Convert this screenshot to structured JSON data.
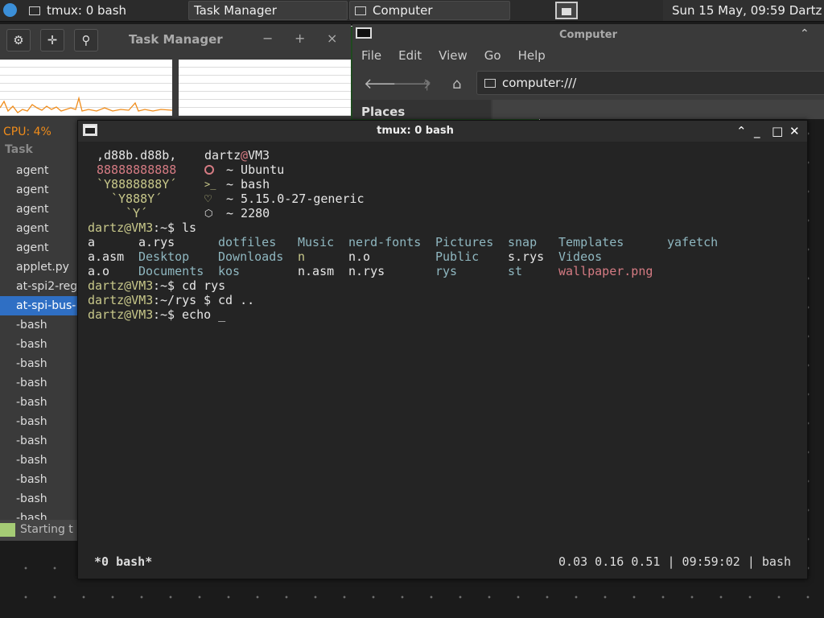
{
  "taskbar": {
    "windows": [
      {
        "label": "tmux: 0 bash"
      },
      {
        "label": "Task Manager"
      },
      {
        "label": "Computer"
      }
    ],
    "clock": "Sun 15 May, 09:59  Dartz"
  },
  "task_manager": {
    "title": "Task Manager",
    "cpu_label": "CPU: 4%",
    "column_header": "Task",
    "tasks": [
      "agent",
      "agent",
      "agent",
      "agent",
      "agent",
      "applet.py",
      "at-spi2-reg",
      "at-spi-bus-",
      "-bash",
      "-bash",
      "-bash",
      "-bash",
      "-bash",
      "-bash",
      "-bash",
      "-bash",
      "-bash",
      "-bash",
      "-bash"
    ],
    "selected_index": 7,
    "status": "Starting t"
  },
  "file_manager": {
    "title": "Computer",
    "menu": [
      "File",
      "Edit",
      "View",
      "Go",
      "Help"
    ],
    "location": "computer:///",
    "places_label": "Places"
  },
  "terminal": {
    "title": "tmux: 0 bash",
    "neofetch": {
      "art": [
        ",d88b.d88b,",
        "88888888888",
        "`Y8888888Y´",
        "`Y888Y´",
        "`Y´"
      ],
      "user": "dartz",
      "at": "@",
      "host": "VM3",
      "os": "~ Ubuntu",
      "shell_icon": ">_",
      "shell": "~ bash",
      "kernel": "~ 5.15.0-27-generic",
      "packages": "~ 2280"
    },
    "prompts": {
      "user_host": "dartz@VM3",
      "home_path": ":~",
      "rys_path": ":~/rys",
      "sigil": "$"
    },
    "commands": {
      "ls": " ls",
      "cd_rys": " cd rys",
      "cd_up": " cd ..",
      "echo": " echo _"
    },
    "ls_output": {
      "row1": [
        "a",
        "a.rys",
        "dotfiles",
        "Music",
        "nerd-fonts",
        "Pictures",
        "snap",
        "Templates",
        "yafetch"
      ],
      "row2": [
        "a.asm",
        "Desktop",
        "Downloads",
        "n",
        "n.o",
        "Public",
        "s.rys",
        "Videos"
      ],
      "row3": [
        "a.o",
        "Documents",
        "kos",
        "n.asm",
        "n.rys",
        "rys",
        "st",
        "wallpaper.png"
      ]
    },
    "status_left": "*0 bash*",
    "status_right": "0.03 0.16 0.51 | 09:59:02 | bash"
  },
  "colors": {
    "prompt": "#c8c88a",
    "directory": "#8fb7c0",
    "image": "#d57b83",
    "cpu": "#f08c1a",
    "selection": "#2f6fc4"
  }
}
